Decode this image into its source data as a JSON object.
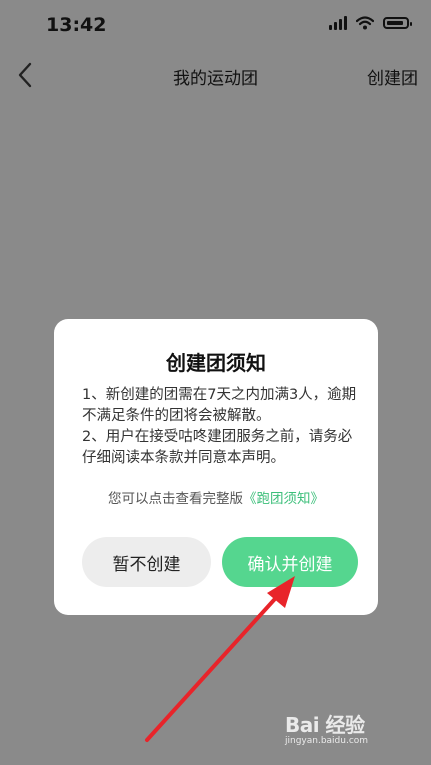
{
  "status_bar": {
    "time": "13:42"
  },
  "nav": {
    "title": "我的运动团",
    "action": "创建团"
  },
  "dialog": {
    "title": "创建团须知",
    "rule_1": "1、新创建的团需在7天之内加满3人，逾期不满足条件的团将会被解散。",
    "rule_2": "2、用户在接受咕咚建团服务之前，请务必仔细阅读本条款并同意本声明。",
    "full_prefix": "您可以点击查看完整版",
    "full_link": "《跑团须知》",
    "cancel_label": "暂不创建",
    "confirm_label": "确认并创建",
    "accent_color": "#55d68f"
  },
  "watermark": {
    "brand": "Bai 经验",
    "url": "jingyan.baidu.com"
  }
}
